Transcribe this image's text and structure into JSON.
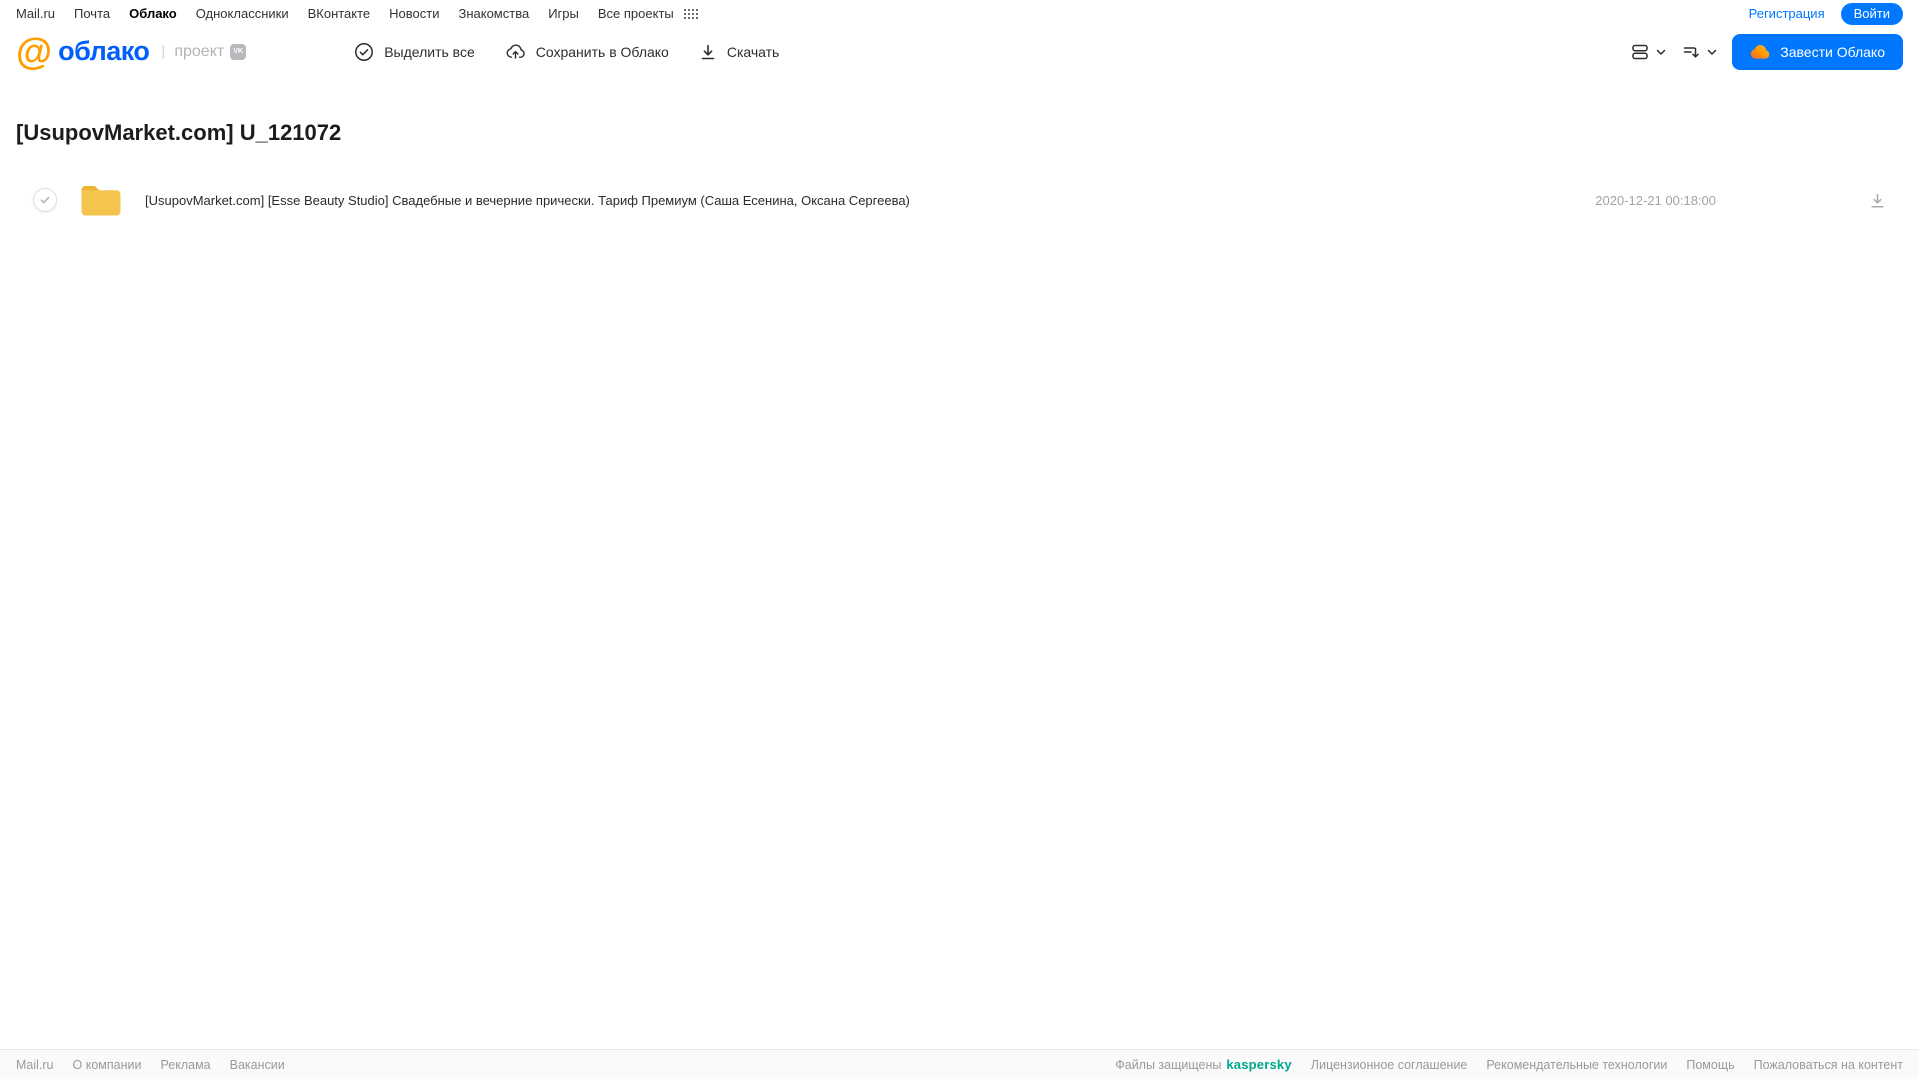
{
  "topbar": {
    "links": [
      {
        "label": "Mail.ru"
      },
      {
        "label": "Почта"
      },
      {
        "label": "Облако",
        "active": true
      },
      {
        "label": "Одноклассники"
      },
      {
        "label": "ВКонтакте"
      },
      {
        "label": "Новости"
      },
      {
        "label": "Знакомства"
      },
      {
        "label": "Игры"
      },
      {
        "label": "Все проекты"
      }
    ],
    "register_label": "Регистрация",
    "login_label": "Войти"
  },
  "header": {
    "at_glyph": "@",
    "logo_text": "облако",
    "separator": "|",
    "project_label": "проект",
    "vk_badge": "VK",
    "actions": [
      {
        "label": "Выделить все",
        "icon": "check-circle-icon"
      },
      {
        "label": "Сохранить в Облако",
        "icon": "cloud-upload-icon"
      },
      {
        "label": "Скачать",
        "icon": "download-icon"
      }
    ],
    "create_cloud_label": "Завести Облако"
  },
  "main": {
    "title": "[UsupovMarket.com] U_121072",
    "files": [
      {
        "type": "folder",
        "name": "[UsupovMarket.com] [Esse Beauty Studio] Свадебные и вечерние прически. Тариф Премиум (Саша Есенина, Оксана Сергеева)",
        "date": "2020-12-21 00:18:00"
      }
    ]
  },
  "footer": {
    "left_links": [
      "Mail.ru",
      "О компании",
      "Реклама",
      "Вакансии"
    ],
    "kaspersky_prefix": "Файлы защищены",
    "kaspersky_brand": "kaspersky",
    "right_links": [
      "Лицензионное соглашение",
      "Рекомендательные технологии",
      "Помощь",
      "Пожаловаться на контент"
    ]
  },
  "icons": {
    "all-projects-grid": "3x4 dot grid",
    "check-circle": "circled checkmark",
    "cloud-upload": "cloud with up arrow",
    "download": "arrow down over line",
    "view-mode": "stacked list rows",
    "sort": "lines with down arrow",
    "chevron-down": "˅",
    "cloud": "orange cloud",
    "folder": "amber folder",
    "checkbox-check": "✓"
  },
  "colors": {
    "accent_blue": "#0077ff",
    "logo_blue": "#005ff9",
    "logo_orange": "#ff9e00",
    "folder_amber": "#f5c44e",
    "kaspersky_green": "#00a88e",
    "muted_grey": "#a3a3a3"
  }
}
